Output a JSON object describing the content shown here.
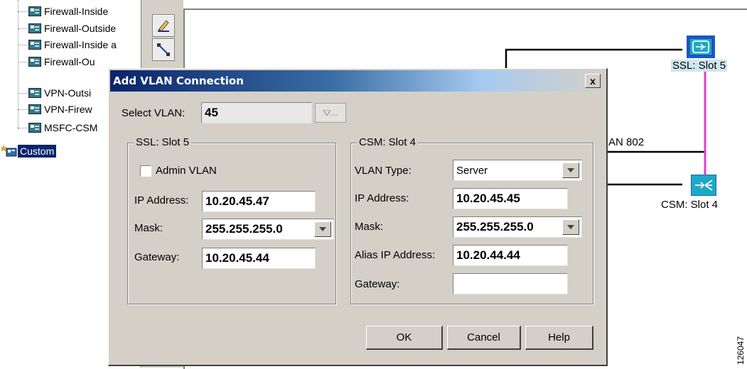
{
  "tree": {
    "items": [
      {
        "label": "Firewall-Inside",
        "icon": "vlan-node-icon"
      },
      {
        "label": "Firewall-Outside",
        "icon": "vlan-node-icon"
      },
      {
        "label": "Firewall-Inside a",
        "icon": "vlan-node-icon"
      },
      {
        "label": "Firewall-Ou",
        "icon": "vlan-node-icon"
      },
      {
        "label": "VPN-Outsi",
        "icon": "vlan-node-icon"
      },
      {
        "label": "VPN-Firew",
        "icon": "vlan-node-icon"
      },
      {
        "label": "MSFC-CSM",
        "icon": "vlan-node-icon"
      }
    ],
    "selected": {
      "label": "Custom",
      "icon": "custom-folder-icon"
    }
  },
  "canvas": {
    "vlan_label": "AN 802",
    "ssl_device": "SSL: Slot 5",
    "csm_device": "CSM: Slot 4",
    "line_colors": {
      "link": "#000000",
      "pink": "#e040c8"
    }
  },
  "dialog": {
    "title": "Add VLAN Connection",
    "close_label": "x",
    "select_vlan_label": "Select VLAN:",
    "select_vlan_value": "45",
    "vlan_browse_label": "...",
    "ssl_group": {
      "title": "SSL: Slot 5",
      "admin_vlan_label": "Admin VLAN",
      "admin_vlan_checked": false,
      "ip_label": "IP Address:",
      "ip_value": "10.20.45.47",
      "mask_label": "Mask:",
      "mask_value": "255.255.255.0",
      "gateway_label": "Gateway:",
      "gateway_value": "10.20.45.44"
    },
    "csm_group": {
      "title": "CSM: Slot 4",
      "vlan_type_label": "VLAN Type:",
      "vlan_type_value": "Server",
      "ip_label": "IP Address:",
      "ip_value": "10.20.45.45",
      "mask_label": "Mask:",
      "mask_value": "255.255.255.0",
      "alias_label": "Alias IP Address:",
      "alias_value": "10.20.44.44",
      "gateway_label": "Gateway:",
      "gateway_value": ""
    },
    "buttons": {
      "ok": "OK",
      "cancel": "Cancel",
      "help": "Help"
    }
  },
  "figure_number": "126047",
  "colors": {
    "titlebar_start": "#0a246a",
    "dialog_face": "#d4d0c8",
    "selection": "#0a246a"
  }
}
